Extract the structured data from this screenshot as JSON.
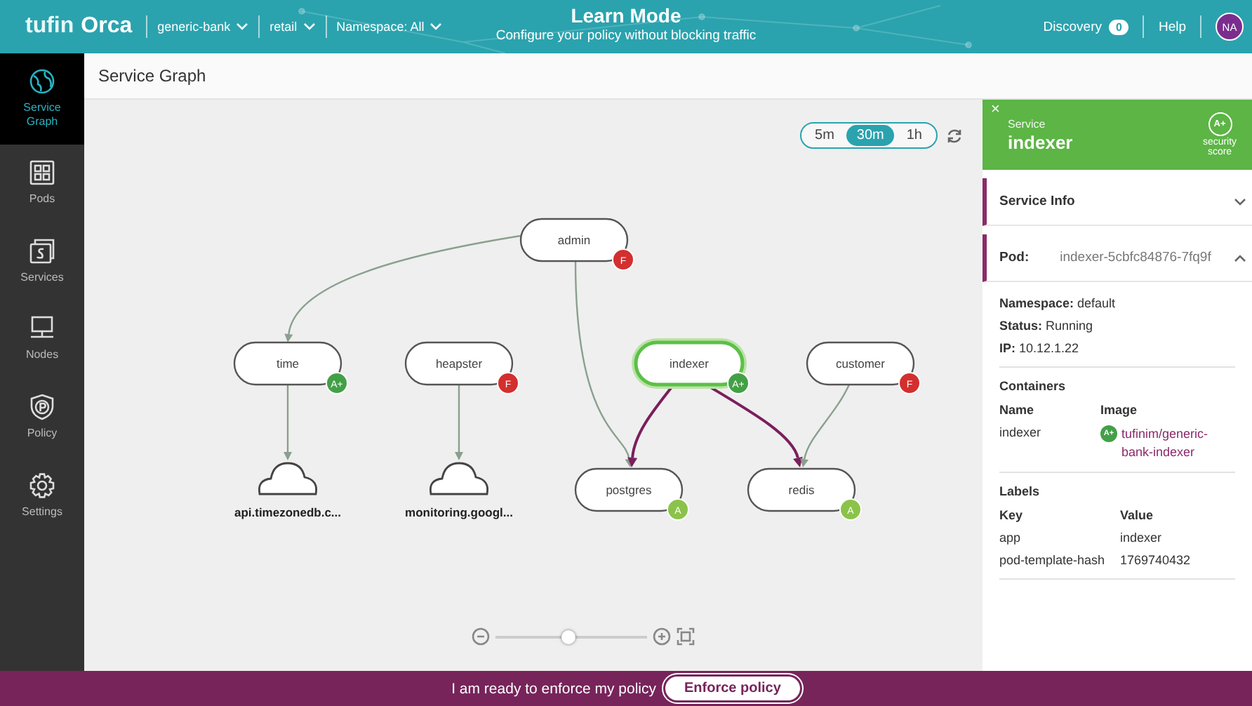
{
  "topbar": {
    "logo_brand": "tufin",
    "logo_product": "Orca",
    "selectors": [
      {
        "label": "generic-bank"
      },
      {
        "label": "retail"
      },
      {
        "label": "Namespace: All"
      }
    ],
    "mode_title": "Learn Mode",
    "mode_subtitle": "Configure your policy without blocking traffic",
    "discovery": {
      "label": "Discovery",
      "count": "0"
    },
    "help": "Help",
    "avatar": "NA"
  },
  "sidebar": {
    "items": [
      {
        "label": "Service Graph",
        "selected": true
      },
      {
        "label": "Pods",
        "selected": false
      },
      {
        "label": "Services",
        "selected": false
      },
      {
        "label": "Nodes",
        "selected": false
      },
      {
        "label": "Policy",
        "selected": false
      },
      {
        "label": "Settings",
        "selected": false
      }
    ]
  },
  "page_title": "Service Graph",
  "time_range": [
    {
      "label": "5m",
      "selected": false
    },
    {
      "label": "30m",
      "selected": true
    },
    {
      "label": "1h",
      "selected": false
    }
  ],
  "graph": {
    "nodes": [
      {
        "kind": "service",
        "label": "admin",
        "grade": "F",
        "color": "#d32f2f",
        "selected": false
      },
      {
        "kind": "service",
        "label": "time",
        "grade": "A+",
        "color": "#43a047",
        "selected": false
      },
      {
        "kind": "service",
        "label": "heapster",
        "grade": "F",
        "color": "#d32f2f",
        "selected": false
      },
      {
        "kind": "service",
        "label": "indexer",
        "grade": "A+",
        "color": "#43a047",
        "selected": true
      },
      {
        "kind": "service",
        "label": "customer",
        "grade": "F",
        "color": "#d32f2f",
        "selected": false
      },
      {
        "kind": "service",
        "label": "postgres",
        "grade": "A",
        "color": "#8bc34a",
        "selected": false
      },
      {
        "kind": "service",
        "label": "redis",
        "grade": "A",
        "color": "#8bc34a",
        "selected": false
      },
      {
        "kind": "external",
        "label": "api.timezonedb.c..."
      },
      {
        "kind": "external",
        "label": "monitoring.googl..."
      }
    ],
    "edges": [
      {
        "highlighted": false
      },
      {
        "highlighted": false
      },
      {
        "highlighted": false
      },
      {
        "highlighted": false
      },
      {
        "highlighted": true
      },
      {
        "highlighted": true
      },
      {
        "highlighted": false
      }
    ],
    "zoom": {
      "level": 0.48
    }
  },
  "panel": {
    "close": "×",
    "subtitle": "Service",
    "title": "indexer",
    "score": "A+",
    "score_label": "security score",
    "sections": [
      {
        "title": "Service Info",
        "expanded": false
      },
      {
        "title": "Pod:",
        "value": "indexer-5cbfc84876-7fq9f",
        "expanded": true
      }
    ],
    "details": [
      {
        "label": "Namespace:",
        "value": "default"
      },
      {
        "label": "Status:",
        "value": "Running"
      },
      {
        "label": "IP:",
        "value": "10.12.1.22"
      }
    ],
    "containers": {
      "heading": "Containers",
      "columns": [
        "Name",
        "Image"
      ],
      "rows": [
        {
          "name": "indexer",
          "grade": "A+",
          "image": "tufinim/generic-bank-indexer"
        }
      ]
    },
    "labels": {
      "heading": "Labels",
      "columns": [
        "Key",
        "Value"
      ],
      "rows": [
        {
          "key": "app",
          "value": "indexer"
        },
        {
          "key": "pod-template-hash",
          "value": "1769740432"
        }
      ]
    }
  },
  "footer": {
    "message": "I am ready to enforce my policy",
    "button": "Enforce policy"
  }
}
